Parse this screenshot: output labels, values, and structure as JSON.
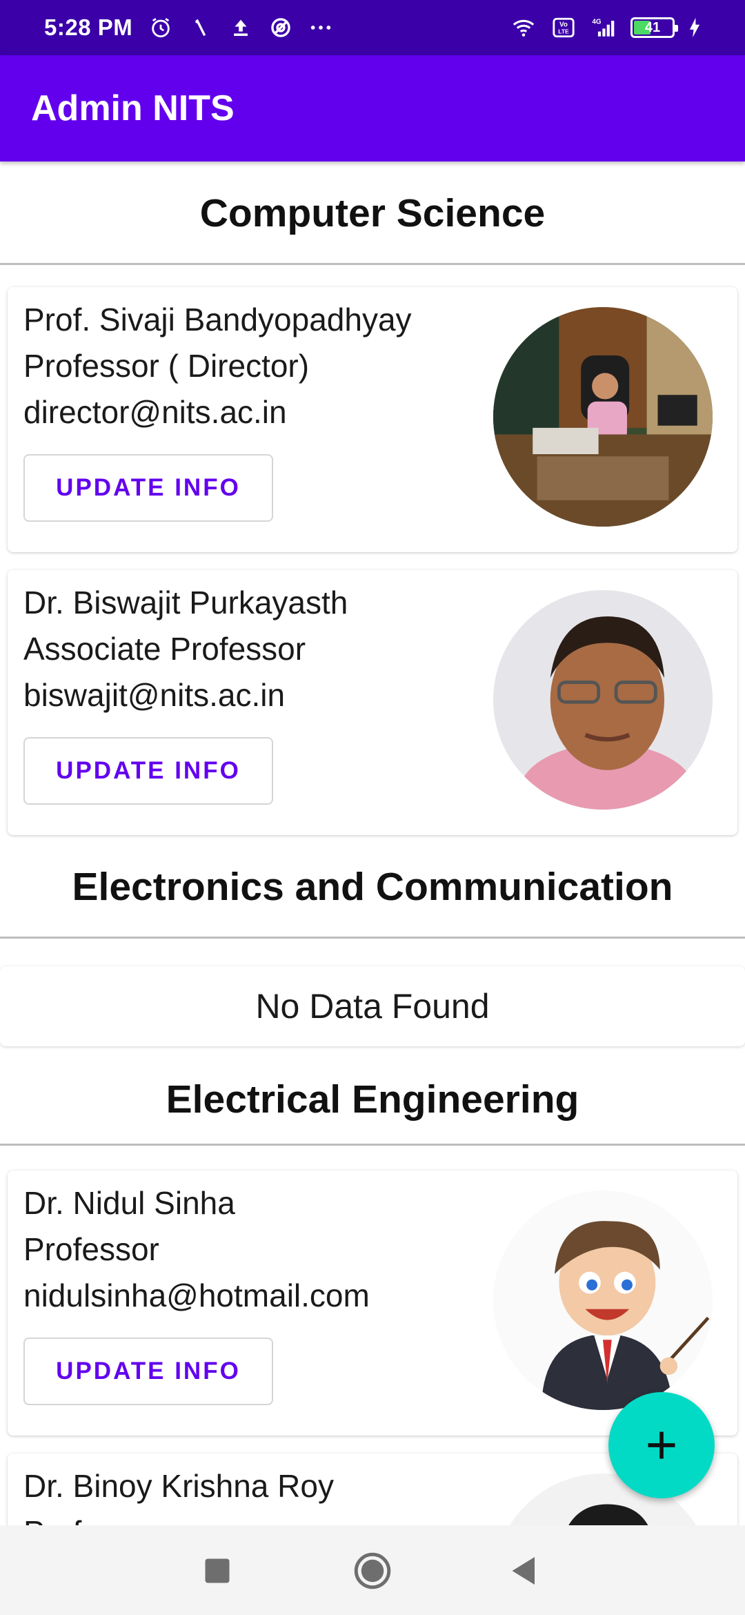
{
  "status_bar": {
    "time": "5:28 PM",
    "battery": "41",
    "icons": [
      "alarm-icon",
      "signal-mute-icon",
      "upload-icon",
      "sync-icon",
      "more-dots-icon",
      "wifi-icon",
      "volte-icon",
      "cellular-4g-icon",
      "battery-icon",
      "charging-icon"
    ]
  },
  "app_bar": {
    "title": "Admin NITS"
  },
  "sections": [
    {
      "title": "Computer Science",
      "items": [
        {
          "name": "Prof. Sivaji Bandyopadhyay",
          "post": "Professor ( Director)",
          "email": "director@nits.ac.in",
          "button": "UPDATE INFO"
        },
        {
          "name": "Dr. Biswajit Purkayasth",
          "post": "Associate Professor",
          "email": "biswajit@nits.ac.in",
          "button": "UPDATE INFO"
        }
      ]
    },
    {
      "title": "Electronics and Communication",
      "empty_text": "No Data Found"
    },
    {
      "title": "Electrical Engineering",
      "items": [
        {
          "name": "Dr. Nidul Sinha",
          "post": "Professor",
          "email": "nidulsinha@hotmail.com",
          "button": "UPDATE INFO"
        },
        {
          "name": "Dr. Binoy Krishna Roy",
          "post": "Prof"
        }
      ]
    }
  ],
  "fab": {
    "icon": "plus-icon"
  },
  "nav_bar": {
    "icons": [
      "recent-apps-icon",
      "home-icon",
      "back-icon"
    ]
  },
  "colors": {
    "status_bar": "#3b00a8",
    "app_bar": "#6200ee",
    "accent_text": "#6200ee",
    "fab": "#03dac5"
  }
}
